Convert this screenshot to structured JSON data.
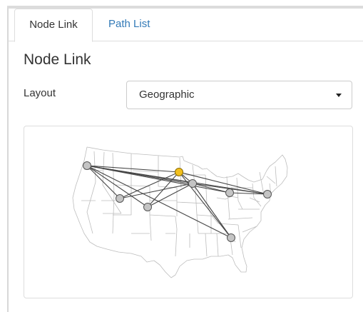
{
  "tabs": [
    {
      "label": "Node Link",
      "active": true
    },
    {
      "label": "Path List",
      "active": false
    }
  ],
  "panel": {
    "title": "Node Link",
    "layout_label": "Layout",
    "layout_value": "Geographic"
  },
  "colors": {
    "tab_link": "#337ab7",
    "node_fill": "#c4c4c4",
    "node_highlight": "#f2c01e",
    "edge": "#333333",
    "map_stroke": "#bdbdbd"
  },
  "map": {
    "icon": "us-states-outline"
  }
}
